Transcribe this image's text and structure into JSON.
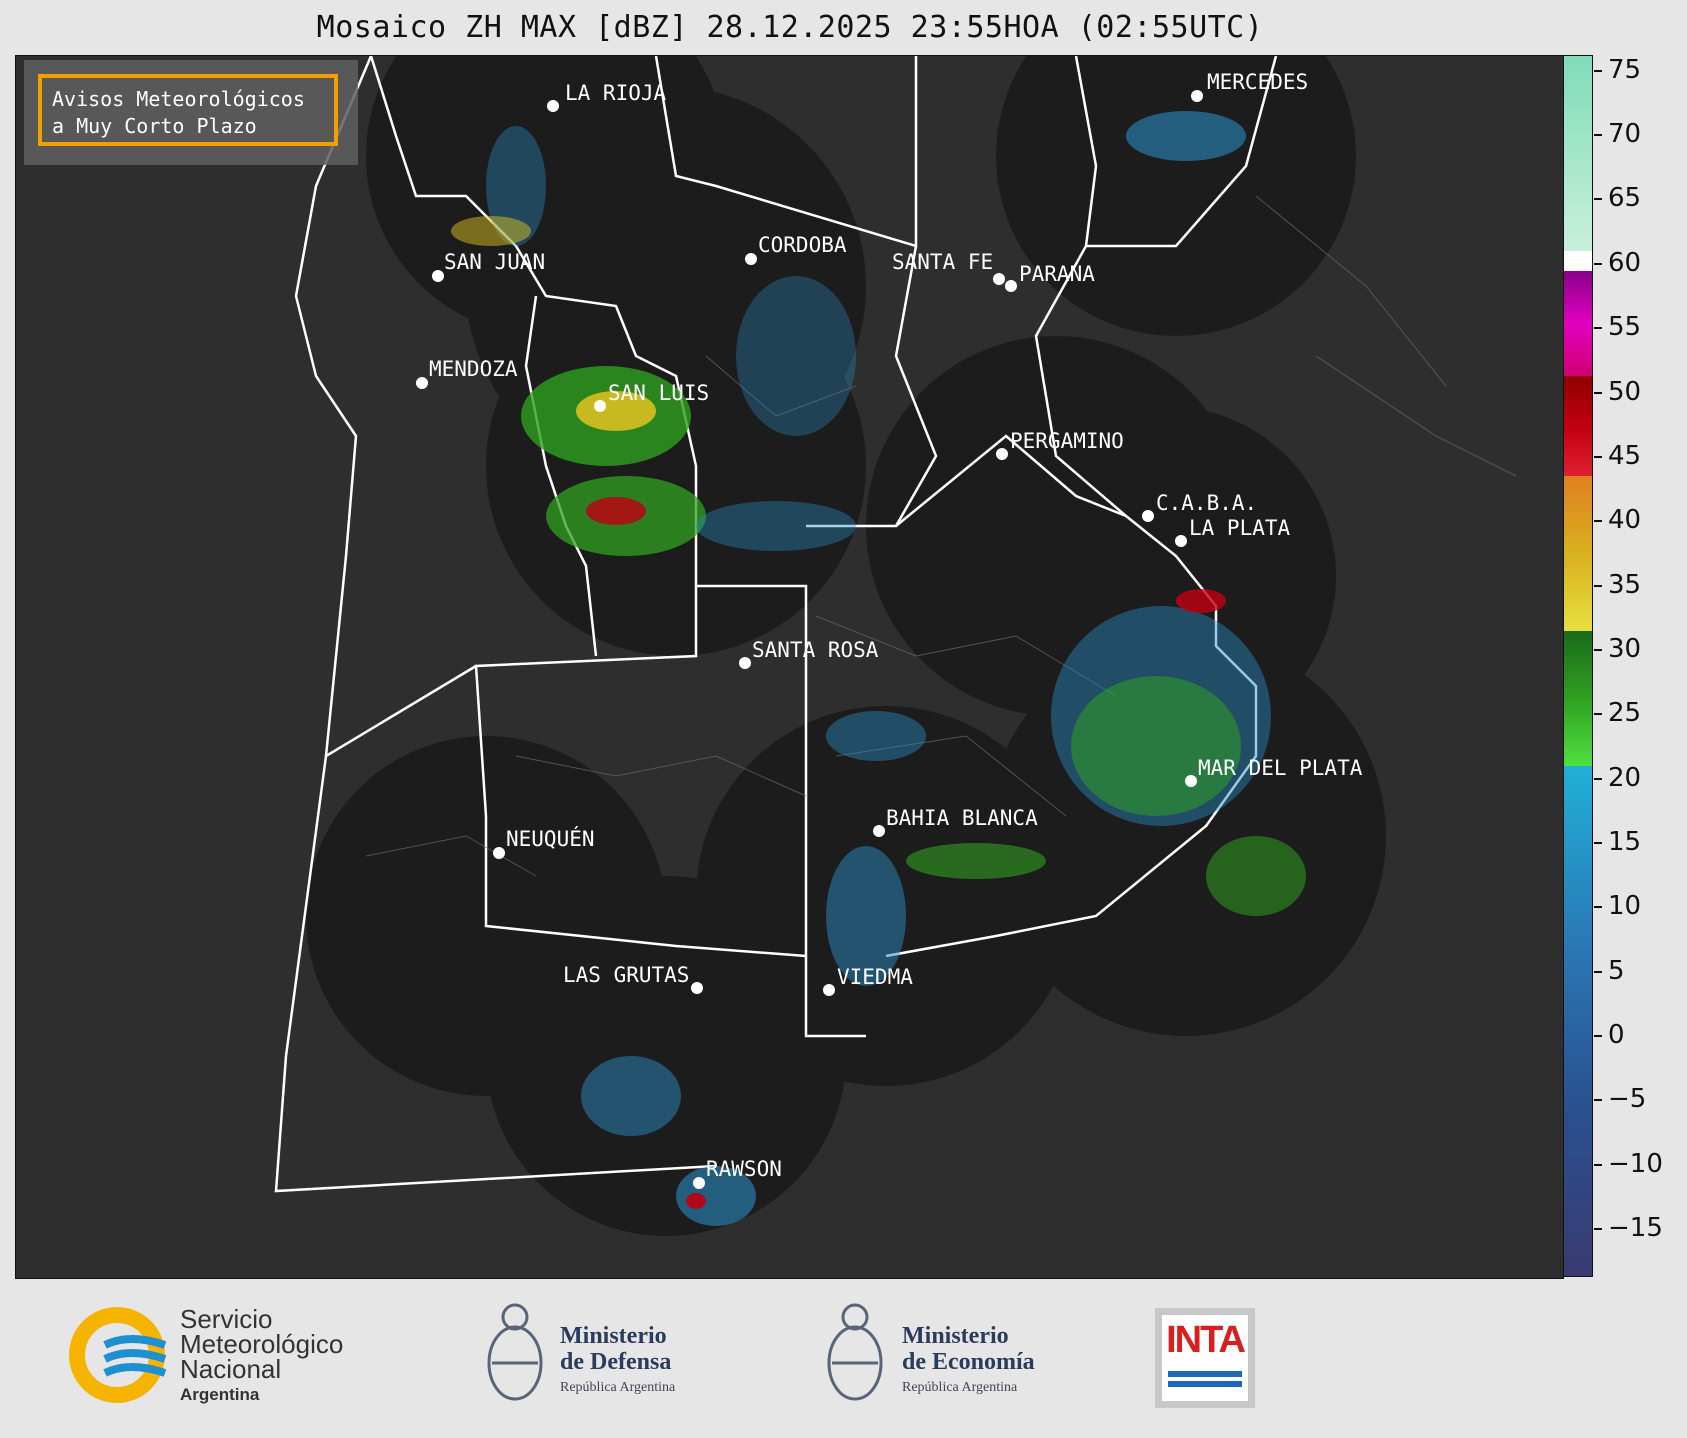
{
  "title": "Mosaico ZH MAX [dBZ] 28.12.2025 23:55HOA (02:55UTC)",
  "notice": {
    "line1": "Avisos Meteorológicos",
    "line2": "a Muy Corto Plazo",
    "border_color": "#f0a000"
  },
  "cities": [
    {
      "name": "LA RIOJA"
    },
    {
      "name": "MERCEDES"
    },
    {
      "name": "CORDOBA"
    },
    {
      "name": "SAN JUAN"
    },
    {
      "name": "SANTA FE"
    },
    {
      "name": "PARANA"
    },
    {
      "name": "MENDOZA"
    },
    {
      "name": "SAN LUIS"
    },
    {
      "name": "PERGAMINO"
    },
    {
      "name": "C.A.B.A."
    },
    {
      "name": "LA PLATA"
    },
    {
      "name": "SANTA ROSA"
    },
    {
      "name": "MAR DEL PLATA"
    },
    {
      "name": "BAHIA BLANCA"
    },
    {
      "name": "NEUQUÉN"
    },
    {
      "name": "LAS GRUTAS"
    },
    {
      "name": "VIEDMA"
    },
    {
      "name": "RAWSON"
    }
  ],
  "colorbar": {
    "unit": "dBZ",
    "ticks": [
      "75",
      "70",
      "65",
      "60",
      "55",
      "50",
      "45",
      "40",
      "35",
      "30",
      "25",
      "20",
      "15",
      "10",
      "5",
      "0",
      "−5",
      "−10",
      "−15"
    ],
    "colors": {
      "gt60": "#7fdcb8",
      "60": "#ffffff",
      "50to60": "#c000c0",
      "40to50": "#c00010",
      "30to40": "#d8c020",
      "20to30": "#30a020",
      "15to20": "#20a8d0",
      "lt15": "#2a5090"
    }
  },
  "footer": {
    "smn": {
      "line1": "Servicio",
      "line2": "Meteorológico",
      "line3": "Nacional",
      "line4": "Argentina"
    },
    "defensa": {
      "line1": "Ministerio",
      "line2": "de Defensa",
      "line3": "República Argentina"
    },
    "economia": {
      "line1": "Ministerio",
      "line2": "de Economía",
      "line3": "República Argentina"
    },
    "inta": {
      "label": "INTA"
    }
  }
}
